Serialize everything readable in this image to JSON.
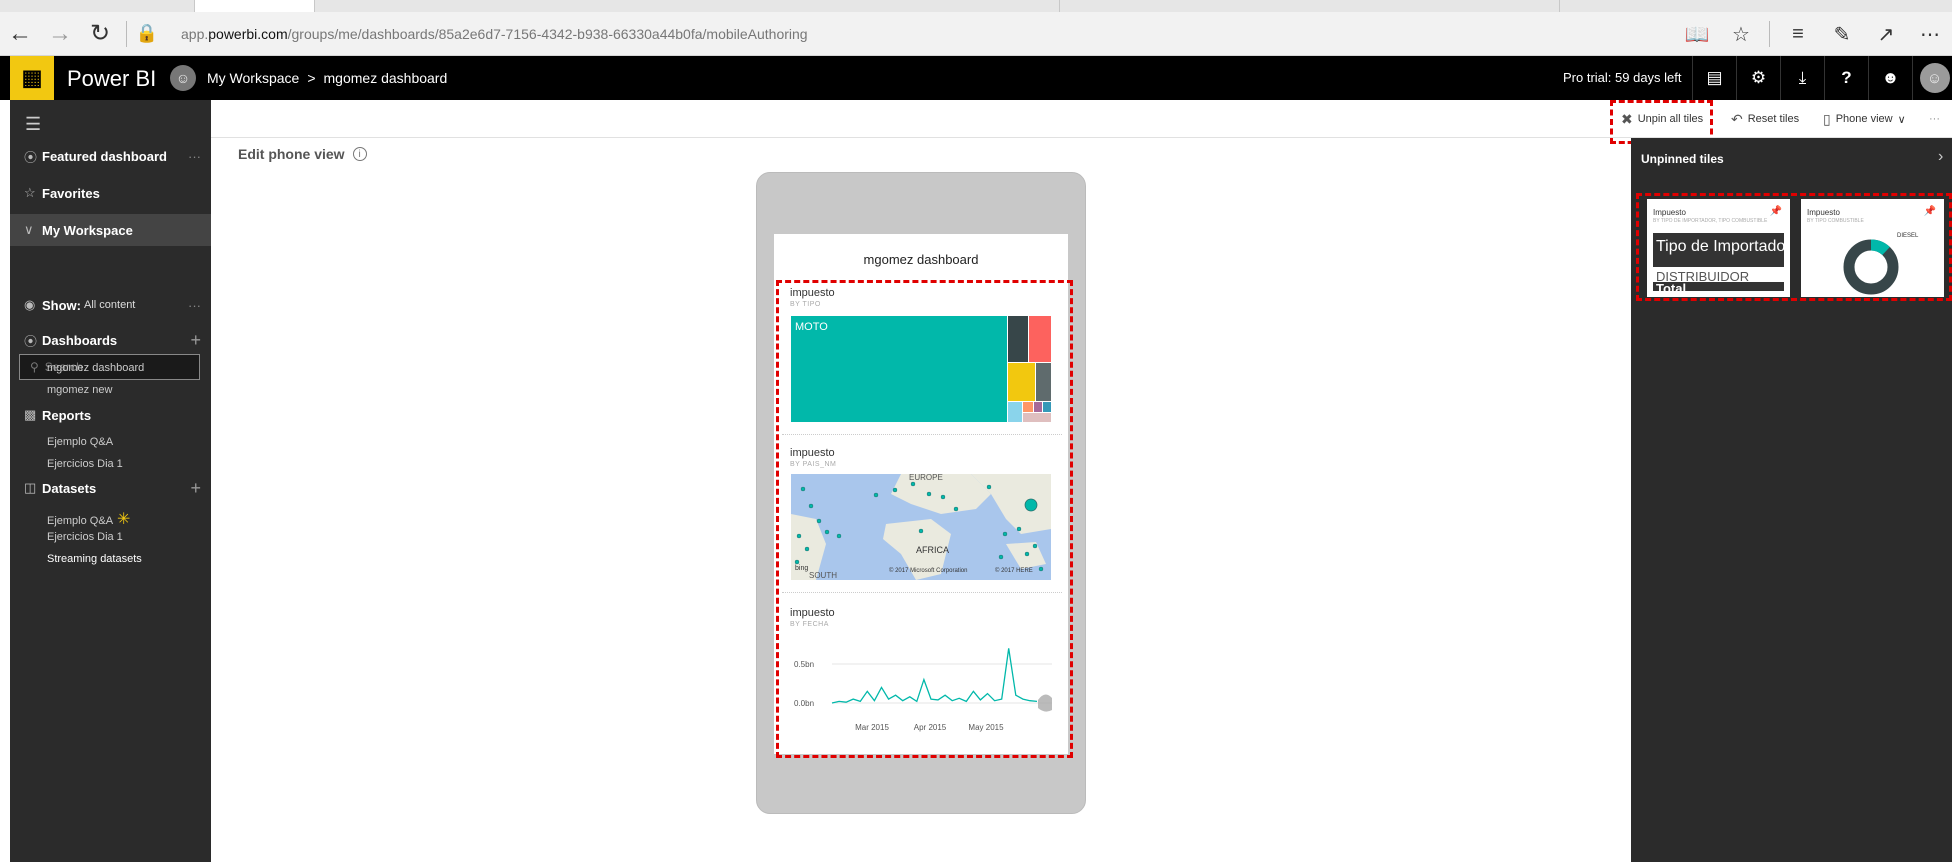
{
  "browser": {
    "url_prefix": "app.",
    "url_host": "powerbi.com",
    "url_path": "/groups/me/dashboards/85a2e6d7-7156-4342-b938-66330a44b0fa/mobileAuthoring"
  },
  "header": {
    "brand": "Power BI",
    "breadcrumb_workspace": "My Workspace",
    "breadcrumb_sep": ">",
    "breadcrumb_dashboard": "mgomez dashboard",
    "trial": "Pro trial: 59 days left"
  },
  "sidebar": {
    "featured": "Featured dashboard",
    "favorites": "Favorites",
    "workspace": "My Workspace",
    "search_placeholder": "Search",
    "show_label": "Show:",
    "show_value": "All content",
    "dashboards": "Dashboards",
    "dashboard_items": [
      "mgomez dashboard",
      "mgomez new"
    ],
    "reports": "Reports",
    "report_items": [
      "Ejemplo Q&A",
      "Ejercicios Dia 1"
    ],
    "datasets": "Datasets",
    "dataset_items": [
      "Ejemplo Q&A",
      "Ejercicios Dia 1",
      "Streaming datasets"
    ]
  },
  "toolbar": {
    "unpin_all": "Unpin all tiles",
    "reset": "Reset tiles",
    "phone_view": "Phone view",
    "more": "···"
  },
  "main": {
    "edit_title": "Edit phone view",
    "dashboard_title": "mgomez dashboard",
    "tiles": [
      {
        "title": "impuesto",
        "subtitle": "BY TIPO",
        "label": "MOTO"
      },
      {
        "title": "impuesto",
        "subtitle": "BY PAIS_NM",
        "map_label_europe": "EUROPE",
        "map_label_africa": "AFRICA",
        "map_label_south": "SOUTH",
        "map_brand": "bing",
        "map_copy1": "© 2017 Microsoft Corporation",
        "map_copy2": "© 2017 HERE"
      },
      {
        "title": "impuesto",
        "subtitle": "BY FECHA"
      }
    ]
  },
  "right_panel": {
    "title": "Unpinned tiles",
    "tile1": {
      "title": "Impuesto",
      "subtitle": "BY TIPO DE IMPORTADOR, TIPO COMBUSTIBLE",
      "big": "Tipo de Importado",
      "mid": "DISTRIBUIDOR",
      "total": "Total"
    },
    "tile2": {
      "title": "Impuesto",
      "subtitle": "BY TIPO COMBUSTIBLE",
      "label": "DIESEL"
    }
  },
  "chart_data": [
    {
      "type": "line",
      "x_ticks": [
        "Mar 2015",
        "Apr 2015",
        "May 2015"
      ],
      "y_ticks": [
        "0.5bn",
        "0.0bn"
      ],
      "series": [
        {
          "values": [
            0.0,
            0.02,
            0.01,
            0.05,
            0.02,
            0.15,
            0.03,
            0.2,
            0.05,
            0.1,
            0.03,
            0.08,
            0.02,
            0.3,
            0.05,
            0.04,
            0.1,
            0.03,
            0.06,
            0.02,
            0.15,
            0.04,
            0.12,
            0.03,
            0.05,
            0.7,
            0.1,
            0.05,
            0.03,
            0.02
          ]
        }
      ],
      "colors": {
        "line": "#01b8aa",
        "forecast": "#9e9e9e"
      }
    },
    {
      "type": "heatmap",
      "description_values": [
        0.88,
        0.12
      ],
      "colors": [
        "#01b8aa",
        "#374649",
        "#fd625e",
        "#f2c80f",
        "#5f6b6d",
        "#8ad4eb"
      ]
    }
  ],
  "colors": {
    "accent": "#f2c811",
    "teal": "#01b8aa",
    "annotation": "#e00000"
  }
}
